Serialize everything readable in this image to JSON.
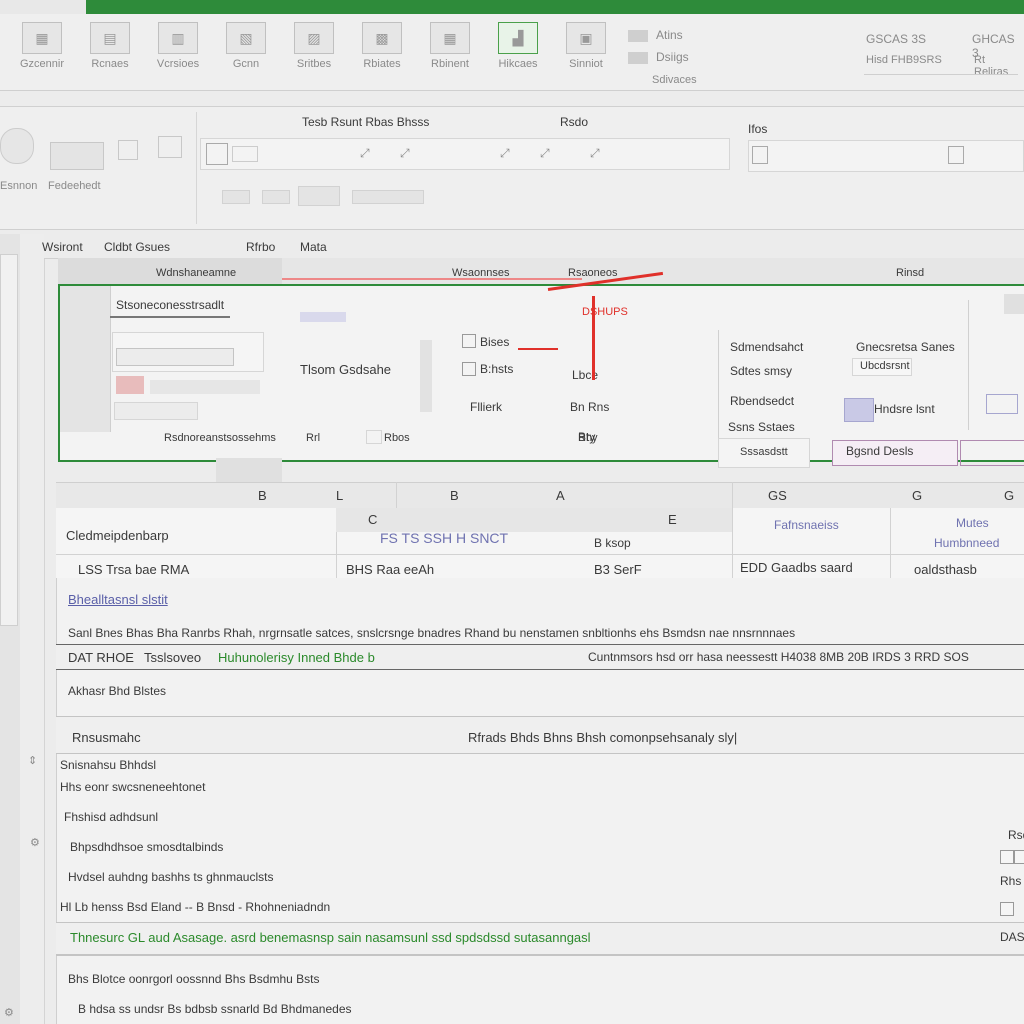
{
  "ribbon": {
    "groups": [
      {
        "label": "Gzcennir"
      },
      {
        "label": "Rcnaes"
      },
      {
        "label": "Vcrsioes"
      },
      {
        "label": "Gcnn"
      },
      {
        "label": "Sritbes"
      },
      {
        "label": "Rbiates"
      },
      {
        "label": "Rbinent"
      },
      {
        "label": "Hikcaes"
      },
      {
        "label": "Sinniot"
      }
    ],
    "right": {
      "a1": "Atins",
      "a2": "Dsiigs",
      "a3": "Sdivaces",
      "b1": "GSCAS 3S",
      "b2": "GHCAS 3",
      "b3": "Hisd FHB9SRS",
      "b4": "Rt Reliras"
    }
  },
  "toolbar": {
    "left_label": "Esnnon",
    "left_label2": "Fedeehedt",
    "section_title": "Tesb   Rsunt Rbas  Bhsss",
    "section_title_2": "Rsdo",
    "right_title": "Ifos"
  },
  "sheet": {
    "tabs": [
      {
        "label": "Wsiront"
      },
      {
        "label": "Cldbt Gsues"
      },
      {
        "label": "Rfrbo"
      },
      {
        "label": "Mata"
      }
    ],
    "subtabs": [
      {
        "label": "Wdnshaneamne"
      },
      {
        "label": "Wsaonnses"
      },
      {
        "label": "Rsaoneos"
      },
      {
        "label": "Rinsd"
      }
    ]
  },
  "dialog": {
    "title": "Stsoneconesstrsadlt",
    "left_label": "Tlsom Gsdsahe",
    "f1": "Bises",
    "f2": "B:hsts",
    "f3": "Fllierk",
    "mid1": "Lbce",
    "mid2": "Bn Rns",
    "mid3": "Bty",
    "red_label": "DSHUPS",
    "right1": "Sdmendsahct",
    "right2": "Sdtes smsy",
    "right3": "Rbendsedct",
    "right4": "Ssns Sstaes",
    "rv1": "Gnecsretsa Sanes",
    "rv2": "Ubcdsrsnt",
    "rv3": "Hndsre lsnt",
    "rv4": "Sssasdstt",
    "rv5": "Bgsnd  Desls",
    "bottom1": "Rsdnoreanstsossehms",
    "bottom2": "Rrl",
    "bottom3": "Rbos",
    "bottom4": "Rhy"
  },
  "columns": {
    "headers": [
      "B",
      "L",
      "B",
      "A",
      "GS",
      "G",
      "G"
    ]
  },
  "table": {
    "row1_label": "Cledmeipdenbarp",
    "row1_mid": "FS  TS  SSH  H  SNCT",
    "row1_sub": "B  ksop",
    "row1_r1": "Fafnsnaeiss",
    "row1_r2": "Mutes",
    "row1_r2b": "Humbnneed",
    "row2_a": "LSS  Trsa bae RMA",
    "row2_b": "BHS Raa eeAh",
    "row2_c": "B3  SerF",
    "row2_d": "EDD  Gaadbs saard",
    "row2_e": "oaldsthasb"
  },
  "body": {
    "link": "Bhealltasnsl  slstit",
    "sentence": "Sanl Bnes Bhas Bha Ranrbs Rhah, nrgrnsatle satces, snslcrsnge bnadres Rhand bu nenstamen snbltionhs ehs Bsmdsn  nae nnsrnnnaes",
    "bar_left": "DAT RHOE",
    "bar_mid1": "Tsslsoveo",
    "bar_mid2": "Huhunolerisy Inned Bhde b",
    "bar_right": "Cuntnmsors hsd  orr hasa neessestt  H4038 8MB   20B IRDS 3 RRD SOS",
    "note": "Akhasr Bhd Blstes",
    "section_left": "Rnsusmahc",
    "section_right": "Rfrads Bhds Bhns Bhsh comonpsehsanaly sly|",
    "items": [
      {
        "text": "Snisnahsu  Bhhdsl"
      },
      {
        "text": "Hhs eonr swcsneneehtonet"
      },
      {
        "text": "Fhshisd adhdsunl"
      },
      {
        "text": "Bhpsdhdhsoe smosdtalbinds"
      },
      {
        "text": "Hvdsel auhdng bashhs ts ghnmauclsts"
      },
      {
        "text": "Hl  Lb  henss  Bsd  Eland  --  B Bnsd  -  Rhohneniadndn"
      }
    ],
    "green_line": "Thnesurc GL aud Asasage. asrd benemasnsp sain nasamsunl ssd  spdsdssd sutasanngasl",
    "footer1": "Bhs Blotce oonrgorl oossnnd   Bhs Bsdmhu Bsts",
    "footer2": "B hdsa ss undsr Bs bdbsb ssnarld Bd Bhdmanedes",
    "side1": "Rsd",
    "side2": "Rhs",
    "side3": "DAS"
  },
  "colors": {
    "accent_green": "#2e8b3a",
    "red": "#e0302a",
    "purple": "#b08ab0"
  }
}
